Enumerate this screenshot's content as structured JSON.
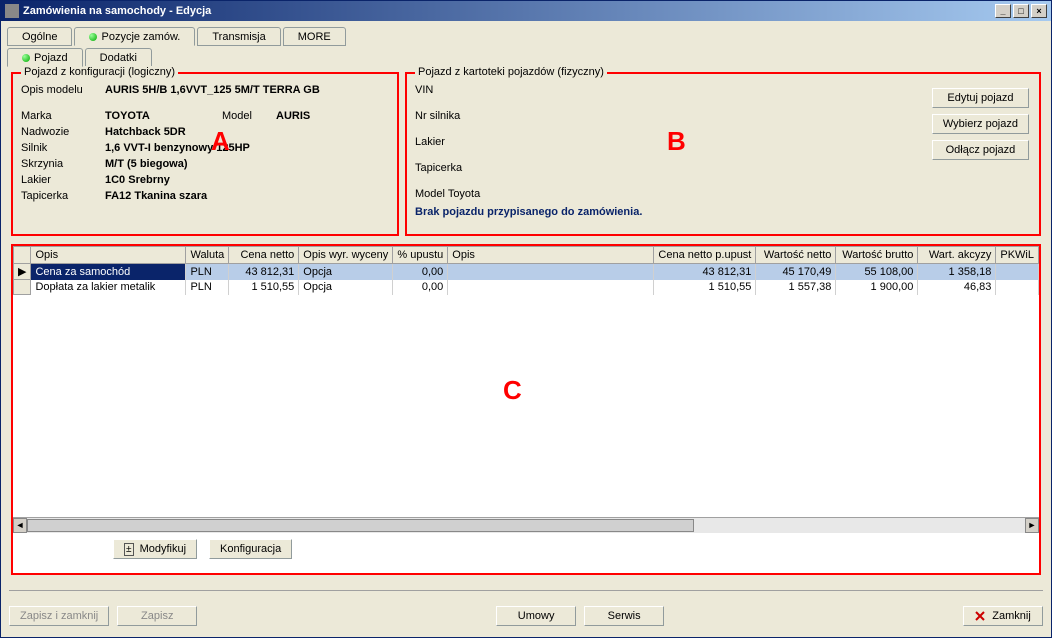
{
  "window": {
    "title": "Zamówienia na samochody - Edycja"
  },
  "main_tabs": {
    "t0": "Ogólne",
    "t1": "Pozycje zamów.",
    "t2": "Transmisja",
    "t3": "MORE"
  },
  "sub_tabs": {
    "s0": "Pojazd",
    "s1": "Dodatki"
  },
  "left_panel": {
    "legend": "Pojazd z konfiguracji (logiczny)",
    "opis_modelu_lbl": "Opis modelu",
    "opis_modelu": "AURIS 5H/B 1,6VVT_125 5M/T TERRA GB",
    "marka_lbl": "Marka",
    "marka": "TOYOTA",
    "model_lbl": "Model",
    "model": "AURIS",
    "nadwozie_lbl": "Nadwozie",
    "nadwozie": "Hatchback 5DR",
    "silnik_lbl": "Silnik",
    "silnik": "1,6 VVT-I benzynowy 125HP",
    "skrzynia_lbl": "Skrzynia",
    "skrzynia": "M/T (5 biegowa)",
    "lakier_lbl": "Lakier",
    "lakier": "1C0 Srebrny",
    "tapicerka_lbl": "Tapicerka",
    "tapicerka": "FA12 Tkanina szara"
  },
  "right_panel": {
    "legend": "Pojazd z kartoteki pojazdów (fizyczny)",
    "vin_lbl": "VIN",
    "nrsilnika_lbl": "Nr silnika",
    "lakier_lbl": "Lakier",
    "tapicerka_lbl": "Tapicerka",
    "modeltoyota_lbl": "Model Toyota",
    "status": "Brak pojazdu przypisanego do zamówienia.",
    "btn_edytuj": "Edytuj pojazd",
    "btn_wybierz": "Wybierz pojazd",
    "btn_odlacz": "Odłącz pojazd"
  },
  "annot": {
    "A": "A",
    "B": "B",
    "C": "C"
  },
  "grid": {
    "headers": {
      "opis": "Opis",
      "waluta": "Waluta",
      "cenanetto": "Cena netto",
      "opiswyr": "Opis wyr. wyceny",
      "upust": "% upustu",
      "opis2": "Opis",
      "cenanettoup": "Cena netto p.upust",
      "wartnetto": "Wartość netto",
      "wartbrutto": "Wartość brutto",
      "wartakcyzy": "Wart. akcyzy",
      "pkwiu": "PKWiL"
    },
    "rows": [
      {
        "opis": "Cena za samochód",
        "waluta": "PLN",
        "cenanetto": "43 812,31",
        "opiswyr": "Opcja",
        "upust": "0,00",
        "opis2": "",
        "cenanettoup": "43 812,31",
        "wartnetto": "45 170,49",
        "wartbrutto": "55 108,00",
        "wartakcyzy": "1 358,18",
        "pkwiu": ""
      },
      {
        "opis": "Dopłata za lakier metalik",
        "waluta": "PLN",
        "cenanetto": "1 510,55",
        "opiswyr": "Opcja",
        "upust": "0,00",
        "opis2": "",
        "cenanettoup": "1 510,55",
        "wartnetto": "1 557,38",
        "wartbrutto": "1 900,00",
        "wartakcyzy": "46,83",
        "pkwiu": ""
      }
    ]
  },
  "mid_buttons": {
    "modyfikuj": "Modyfikuj",
    "konfiguracja": "Konfiguracja"
  },
  "bottom": {
    "zapisz_zamknij": "Zapisz i zamknij",
    "zapisz": "Zapisz",
    "umowy": "Umowy",
    "serwis": "Serwis",
    "zamknij": "Zamknij"
  }
}
